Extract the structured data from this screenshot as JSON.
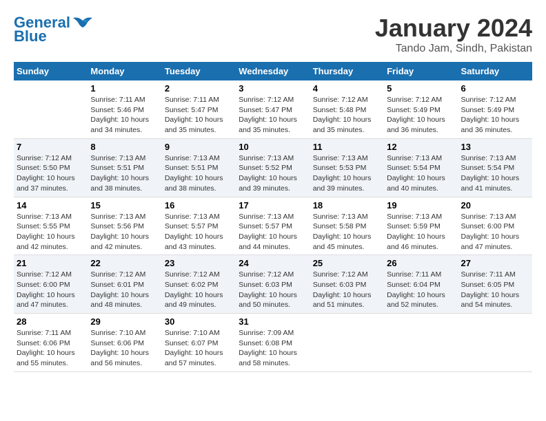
{
  "header": {
    "logo_line1": "General",
    "logo_line2": "Blue",
    "month_title": "January 2024",
    "location": "Tando Jam, Sindh, Pakistan"
  },
  "days_of_week": [
    "Sunday",
    "Monday",
    "Tuesday",
    "Wednesday",
    "Thursday",
    "Friday",
    "Saturday"
  ],
  "weeks": [
    {
      "days": [
        {
          "number": "",
          "info": ""
        },
        {
          "number": "1",
          "info": "Sunrise: 7:11 AM\nSunset: 5:46 PM\nDaylight: 10 hours\nand 34 minutes."
        },
        {
          "number": "2",
          "info": "Sunrise: 7:11 AM\nSunset: 5:47 PM\nDaylight: 10 hours\nand 35 minutes."
        },
        {
          "number": "3",
          "info": "Sunrise: 7:12 AM\nSunset: 5:47 PM\nDaylight: 10 hours\nand 35 minutes."
        },
        {
          "number": "4",
          "info": "Sunrise: 7:12 AM\nSunset: 5:48 PM\nDaylight: 10 hours\nand 35 minutes."
        },
        {
          "number": "5",
          "info": "Sunrise: 7:12 AM\nSunset: 5:49 PM\nDaylight: 10 hours\nand 36 minutes."
        },
        {
          "number": "6",
          "info": "Sunrise: 7:12 AM\nSunset: 5:49 PM\nDaylight: 10 hours\nand 36 minutes."
        }
      ]
    },
    {
      "days": [
        {
          "number": "7",
          "info": "Sunrise: 7:12 AM\nSunset: 5:50 PM\nDaylight: 10 hours\nand 37 minutes."
        },
        {
          "number": "8",
          "info": "Sunrise: 7:13 AM\nSunset: 5:51 PM\nDaylight: 10 hours\nand 38 minutes."
        },
        {
          "number": "9",
          "info": "Sunrise: 7:13 AM\nSunset: 5:51 PM\nDaylight: 10 hours\nand 38 minutes."
        },
        {
          "number": "10",
          "info": "Sunrise: 7:13 AM\nSunset: 5:52 PM\nDaylight: 10 hours\nand 39 minutes."
        },
        {
          "number": "11",
          "info": "Sunrise: 7:13 AM\nSunset: 5:53 PM\nDaylight: 10 hours\nand 39 minutes."
        },
        {
          "number": "12",
          "info": "Sunrise: 7:13 AM\nSunset: 5:54 PM\nDaylight: 10 hours\nand 40 minutes."
        },
        {
          "number": "13",
          "info": "Sunrise: 7:13 AM\nSunset: 5:54 PM\nDaylight: 10 hours\nand 41 minutes."
        }
      ]
    },
    {
      "days": [
        {
          "number": "14",
          "info": "Sunrise: 7:13 AM\nSunset: 5:55 PM\nDaylight: 10 hours\nand 42 minutes."
        },
        {
          "number": "15",
          "info": "Sunrise: 7:13 AM\nSunset: 5:56 PM\nDaylight: 10 hours\nand 42 minutes."
        },
        {
          "number": "16",
          "info": "Sunrise: 7:13 AM\nSunset: 5:57 PM\nDaylight: 10 hours\nand 43 minutes."
        },
        {
          "number": "17",
          "info": "Sunrise: 7:13 AM\nSunset: 5:57 PM\nDaylight: 10 hours\nand 44 minutes."
        },
        {
          "number": "18",
          "info": "Sunrise: 7:13 AM\nSunset: 5:58 PM\nDaylight: 10 hours\nand 45 minutes."
        },
        {
          "number": "19",
          "info": "Sunrise: 7:13 AM\nSunset: 5:59 PM\nDaylight: 10 hours\nand 46 minutes."
        },
        {
          "number": "20",
          "info": "Sunrise: 7:13 AM\nSunset: 6:00 PM\nDaylight: 10 hours\nand 47 minutes."
        }
      ]
    },
    {
      "days": [
        {
          "number": "21",
          "info": "Sunrise: 7:12 AM\nSunset: 6:00 PM\nDaylight: 10 hours\nand 47 minutes."
        },
        {
          "number": "22",
          "info": "Sunrise: 7:12 AM\nSunset: 6:01 PM\nDaylight: 10 hours\nand 48 minutes."
        },
        {
          "number": "23",
          "info": "Sunrise: 7:12 AM\nSunset: 6:02 PM\nDaylight: 10 hours\nand 49 minutes."
        },
        {
          "number": "24",
          "info": "Sunrise: 7:12 AM\nSunset: 6:03 PM\nDaylight: 10 hours\nand 50 minutes."
        },
        {
          "number": "25",
          "info": "Sunrise: 7:12 AM\nSunset: 6:03 PM\nDaylight: 10 hours\nand 51 minutes."
        },
        {
          "number": "26",
          "info": "Sunrise: 7:11 AM\nSunset: 6:04 PM\nDaylight: 10 hours\nand 52 minutes."
        },
        {
          "number": "27",
          "info": "Sunrise: 7:11 AM\nSunset: 6:05 PM\nDaylight: 10 hours\nand 54 minutes."
        }
      ]
    },
    {
      "days": [
        {
          "number": "28",
          "info": "Sunrise: 7:11 AM\nSunset: 6:06 PM\nDaylight: 10 hours\nand 55 minutes."
        },
        {
          "number": "29",
          "info": "Sunrise: 7:10 AM\nSunset: 6:06 PM\nDaylight: 10 hours\nand 56 minutes."
        },
        {
          "number": "30",
          "info": "Sunrise: 7:10 AM\nSunset: 6:07 PM\nDaylight: 10 hours\nand 57 minutes."
        },
        {
          "number": "31",
          "info": "Sunrise: 7:09 AM\nSunset: 6:08 PM\nDaylight: 10 hours\nand 58 minutes."
        },
        {
          "number": "",
          "info": ""
        },
        {
          "number": "",
          "info": ""
        },
        {
          "number": "",
          "info": ""
        }
      ]
    }
  ]
}
